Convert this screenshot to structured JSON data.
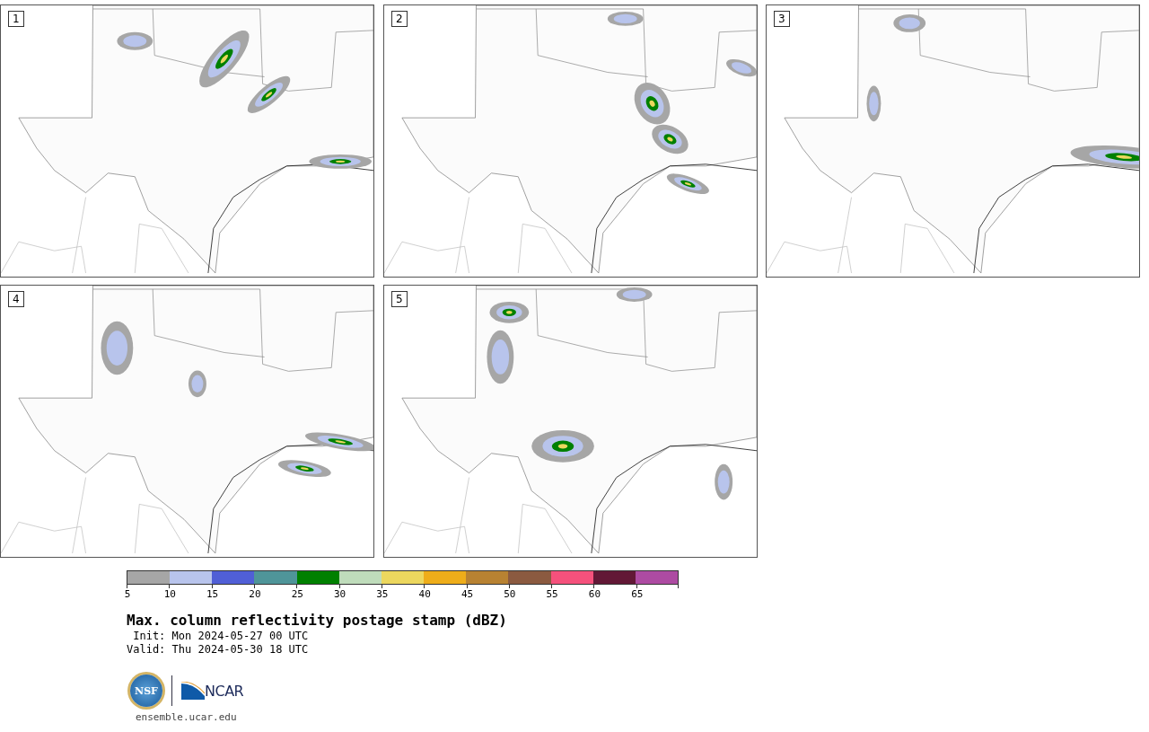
{
  "panels": [
    {
      "label": "1"
    },
    {
      "label": "2"
    },
    {
      "label": "3"
    },
    {
      "label": "4"
    },
    {
      "label": "5"
    }
  ],
  "colorbar": {
    "bins": [
      {
        "tick": "5",
        "color": "#a6a6a6"
      },
      {
        "tick": "10",
        "color": "#b8c4ec"
      },
      {
        "tick": "15",
        "color": "#505fd6"
      },
      {
        "tick": "20",
        "color": "#4f9599"
      },
      {
        "tick": "25",
        "color": "#008000"
      },
      {
        "tick": "30",
        "color": "#bfdcbb"
      },
      {
        "tick": "35",
        "color": "#ecd75e"
      },
      {
        "tick": "40",
        "color": "#eead1a"
      },
      {
        "tick": "45",
        "color": "#b88232"
      },
      {
        "tick": "50",
        "color": "#8b5a40"
      },
      {
        "tick": "55",
        "color": "#f5517c"
      },
      {
        "tick": "60",
        "color": "#621836"
      },
      {
        "tick": "65",
        "color": "#ad4ba2"
      }
    ]
  },
  "title": "Max. column reflectivity postage stamp (dBZ)",
  "init": " Init: Mon 2024-05-27 00 UTC",
  "valid": "Valid: Thu 2024-05-30 18 UTC",
  "logos": {
    "nsf": "NSF",
    "ncar": "NCAR"
  },
  "footer": "ensemble.ucar.edu"
}
